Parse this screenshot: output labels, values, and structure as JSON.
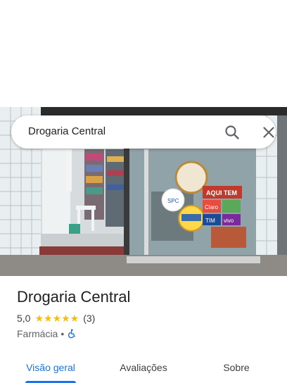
{
  "search": {
    "query": "Drogaria Central",
    "search_icon": "search-icon",
    "close_icon": "close-icon"
  },
  "photo": {
    "window_labels": {
      "aqui_tem": "AQUI TEM",
      "claro": "Claro",
      "tim": "TIM",
      "vivo": "vivo",
      "spc": "SPC"
    }
  },
  "place": {
    "name": "Drogaria Central",
    "rating": "5,0",
    "stars": "★★★★★",
    "reviews": "(3)",
    "category": "Farmácia",
    "separator": "•",
    "accessibility_icon": "wheelchair-icon"
  },
  "tabs": [
    {
      "label": "Visão geral",
      "active": true
    },
    {
      "label": "Avaliações",
      "active": false
    },
    {
      "label": "Sobre",
      "active": false
    }
  ],
  "colors": {
    "accent": "#1a73e8",
    "star": "#fbbc04",
    "text_primary": "#202124",
    "text_secondary": "#5f6368"
  }
}
